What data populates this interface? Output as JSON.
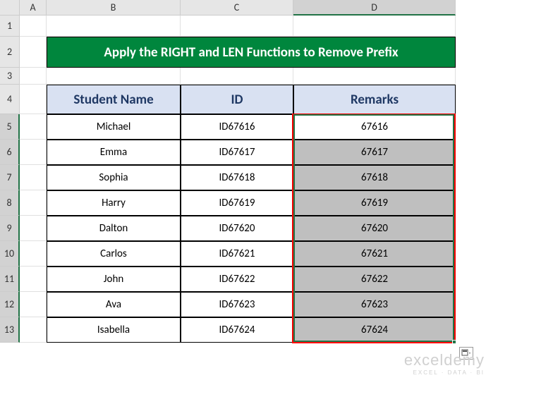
{
  "columns": [
    "A",
    "B",
    "C",
    "D"
  ],
  "rows": [
    "1",
    "2",
    "3",
    "4",
    "5",
    "6",
    "7",
    "8",
    "9",
    "10",
    "11",
    "12",
    "13"
  ],
  "title": "Apply the RIGHT and LEN Functions to Remove Prefix",
  "headers": {
    "name": "Student Name",
    "id": "ID",
    "remarks": "Remarks"
  },
  "students": [
    {
      "name": "Michael",
      "id": "ID67616",
      "remarks": "67616"
    },
    {
      "name": "Emma",
      "id": "ID67617",
      "remarks": "67617"
    },
    {
      "name": "Sophia",
      "id": "ID67618",
      "remarks": "67618"
    },
    {
      "name": "Harry",
      "id": "ID67619",
      "remarks": "67619"
    },
    {
      "name": "Dalton",
      "id": "ID67620",
      "remarks": "67620"
    },
    {
      "name": "Carlos",
      "id": "ID67621",
      "remarks": "67621"
    },
    {
      "name": "John",
      "id": "ID67622",
      "remarks": "67622"
    },
    {
      "name": "Ava",
      "id": "ID67623",
      "remarks": "67623"
    },
    {
      "name": "Isabella",
      "id": "ID67624",
      "remarks": "67624"
    }
  ],
  "watermark": {
    "main": "exceldemy",
    "sub": "EXCEL · DATA · BI"
  },
  "chart_data": {
    "type": "table",
    "title": "Apply the RIGHT and LEN Functions to Remove Prefix",
    "columns": [
      "Student Name",
      "ID",
      "Remarks"
    ],
    "rows": [
      [
        "Michael",
        "ID67616",
        "67616"
      ],
      [
        "Emma",
        "ID67617",
        "67617"
      ],
      [
        "Sophia",
        "ID67618",
        "67618"
      ],
      [
        "Harry",
        "ID67619",
        "67619"
      ],
      [
        "Dalton",
        "ID67620",
        "67620"
      ],
      [
        "Carlos",
        "ID67621",
        "67621"
      ],
      [
        "John",
        "ID67622",
        "67622"
      ],
      [
        "Ava",
        "ID67623",
        "67623"
      ],
      [
        "Isabella",
        "ID67624",
        "67624"
      ]
    ]
  }
}
